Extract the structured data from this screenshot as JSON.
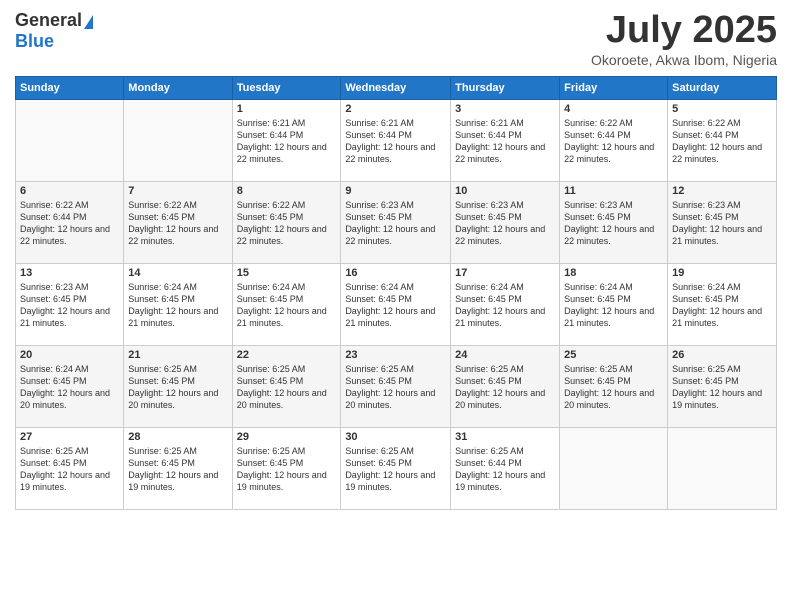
{
  "header": {
    "logo_line1": "General",
    "logo_line2": "Blue",
    "month": "July 2025",
    "location": "Okoroete, Akwa Ibom, Nigeria"
  },
  "days_of_week": [
    "Sunday",
    "Monday",
    "Tuesday",
    "Wednesday",
    "Thursday",
    "Friday",
    "Saturday"
  ],
  "weeks": [
    [
      {
        "day": "",
        "info": ""
      },
      {
        "day": "",
        "info": ""
      },
      {
        "day": "1",
        "info": "Sunrise: 6:21 AM\nSunset: 6:44 PM\nDaylight: 12 hours and 22 minutes."
      },
      {
        "day": "2",
        "info": "Sunrise: 6:21 AM\nSunset: 6:44 PM\nDaylight: 12 hours and 22 minutes."
      },
      {
        "day": "3",
        "info": "Sunrise: 6:21 AM\nSunset: 6:44 PM\nDaylight: 12 hours and 22 minutes."
      },
      {
        "day": "4",
        "info": "Sunrise: 6:22 AM\nSunset: 6:44 PM\nDaylight: 12 hours and 22 minutes."
      },
      {
        "day": "5",
        "info": "Sunrise: 6:22 AM\nSunset: 6:44 PM\nDaylight: 12 hours and 22 minutes."
      }
    ],
    [
      {
        "day": "6",
        "info": "Sunrise: 6:22 AM\nSunset: 6:44 PM\nDaylight: 12 hours and 22 minutes."
      },
      {
        "day": "7",
        "info": "Sunrise: 6:22 AM\nSunset: 6:45 PM\nDaylight: 12 hours and 22 minutes."
      },
      {
        "day": "8",
        "info": "Sunrise: 6:22 AM\nSunset: 6:45 PM\nDaylight: 12 hours and 22 minutes."
      },
      {
        "day": "9",
        "info": "Sunrise: 6:23 AM\nSunset: 6:45 PM\nDaylight: 12 hours and 22 minutes."
      },
      {
        "day": "10",
        "info": "Sunrise: 6:23 AM\nSunset: 6:45 PM\nDaylight: 12 hours and 22 minutes."
      },
      {
        "day": "11",
        "info": "Sunrise: 6:23 AM\nSunset: 6:45 PM\nDaylight: 12 hours and 22 minutes."
      },
      {
        "day": "12",
        "info": "Sunrise: 6:23 AM\nSunset: 6:45 PM\nDaylight: 12 hours and 21 minutes."
      }
    ],
    [
      {
        "day": "13",
        "info": "Sunrise: 6:23 AM\nSunset: 6:45 PM\nDaylight: 12 hours and 21 minutes."
      },
      {
        "day": "14",
        "info": "Sunrise: 6:24 AM\nSunset: 6:45 PM\nDaylight: 12 hours and 21 minutes."
      },
      {
        "day": "15",
        "info": "Sunrise: 6:24 AM\nSunset: 6:45 PM\nDaylight: 12 hours and 21 minutes."
      },
      {
        "day": "16",
        "info": "Sunrise: 6:24 AM\nSunset: 6:45 PM\nDaylight: 12 hours and 21 minutes."
      },
      {
        "day": "17",
        "info": "Sunrise: 6:24 AM\nSunset: 6:45 PM\nDaylight: 12 hours and 21 minutes."
      },
      {
        "day": "18",
        "info": "Sunrise: 6:24 AM\nSunset: 6:45 PM\nDaylight: 12 hours and 21 minutes."
      },
      {
        "day": "19",
        "info": "Sunrise: 6:24 AM\nSunset: 6:45 PM\nDaylight: 12 hours and 21 minutes."
      }
    ],
    [
      {
        "day": "20",
        "info": "Sunrise: 6:24 AM\nSunset: 6:45 PM\nDaylight: 12 hours and 20 minutes."
      },
      {
        "day": "21",
        "info": "Sunrise: 6:25 AM\nSunset: 6:45 PM\nDaylight: 12 hours and 20 minutes."
      },
      {
        "day": "22",
        "info": "Sunrise: 6:25 AM\nSunset: 6:45 PM\nDaylight: 12 hours and 20 minutes."
      },
      {
        "day": "23",
        "info": "Sunrise: 6:25 AM\nSunset: 6:45 PM\nDaylight: 12 hours and 20 minutes."
      },
      {
        "day": "24",
        "info": "Sunrise: 6:25 AM\nSunset: 6:45 PM\nDaylight: 12 hours and 20 minutes."
      },
      {
        "day": "25",
        "info": "Sunrise: 6:25 AM\nSunset: 6:45 PM\nDaylight: 12 hours and 20 minutes."
      },
      {
        "day": "26",
        "info": "Sunrise: 6:25 AM\nSunset: 6:45 PM\nDaylight: 12 hours and 19 minutes."
      }
    ],
    [
      {
        "day": "27",
        "info": "Sunrise: 6:25 AM\nSunset: 6:45 PM\nDaylight: 12 hours and 19 minutes."
      },
      {
        "day": "28",
        "info": "Sunrise: 6:25 AM\nSunset: 6:45 PM\nDaylight: 12 hours and 19 minutes."
      },
      {
        "day": "29",
        "info": "Sunrise: 6:25 AM\nSunset: 6:45 PM\nDaylight: 12 hours and 19 minutes."
      },
      {
        "day": "30",
        "info": "Sunrise: 6:25 AM\nSunset: 6:45 PM\nDaylight: 12 hours and 19 minutes."
      },
      {
        "day": "31",
        "info": "Sunrise: 6:25 AM\nSunset: 6:44 PM\nDaylight: 12 hours and 19 minutes."
      },
      {
        "day": "",
        "info": ""
      },
      {
        "day": "",
        "info": ""
      }
    ]
  ]
}
